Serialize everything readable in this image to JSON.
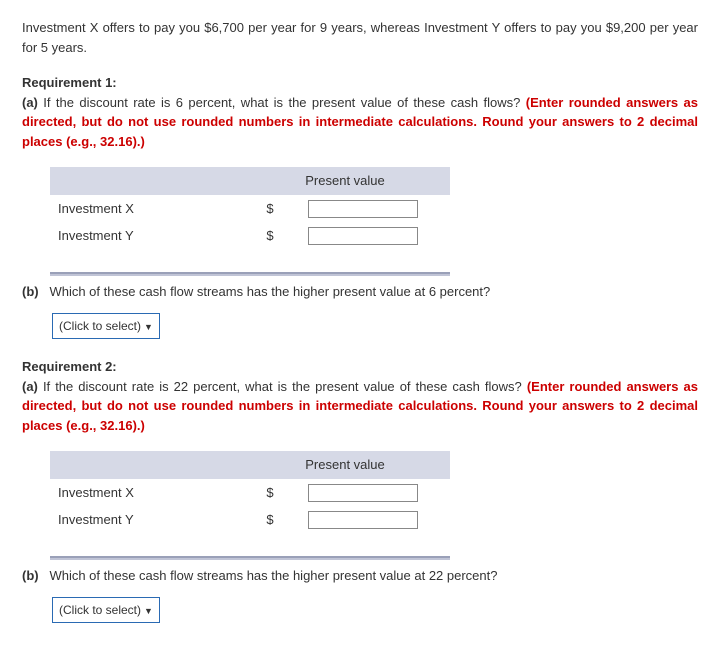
{
  "intro": "Investment X offers to pay you $6,700 per year for 9 years, whereas Investment Y offers to pay you $9,200 per year for 5 years.",
  "req1": {
    "heading": "Requirement 1:",
    "a_label": "(a)",
    "a_text": "If the discount rate is 6 percent, what is the present value of these cash flows? ",
    "instruction": "(Enter rounded answers as directed, but do not use rounded numbers in intermediate calculations. Round your answers to 2 decimal places (e.g., 32.16).)",
    "table": {
      "header": "Present value",
      "rows": [
        {
          "label": "Investment X",
          "currency": "$",
          "value": ""
        },
        {
          "label": "Investment Y",
          "currency": "$",
          "value": ""
        }
      ]
    },
    "b_label": "(b)",
    "b_text": "Which of these cash flow streams has the higher present value at 6 percent?",
    "select_placeholder": "(Click to select)"
  },
  "req2": {
    "heading": "Requirement 2:",
    "a_label": "(a)",
    "a_text": "If the discount rate is 22 percent, what is the present value of these cash flows? ",
    "instruction": "(Enter rounded answers as directed, but do not use rounded numbers in intermediate calculations. Round your answers to 2 decimal places (e.g., 32.16).)",
    "table": {
      "header": "Present value",
      "rows": [
        {
          "label": "Investment X",
          "currency": "$",
          "value": ""
        },
        {
          "label": "Investment Y",
          "currency": "$",
          "value": ""
        }
      ]
    },
    "b_label": "(b)",
    "b_text": "Which of these cash flow streams has the higher present value at 22 percent?",
    "select_placeholder": "(Click to select)"
  }
}
